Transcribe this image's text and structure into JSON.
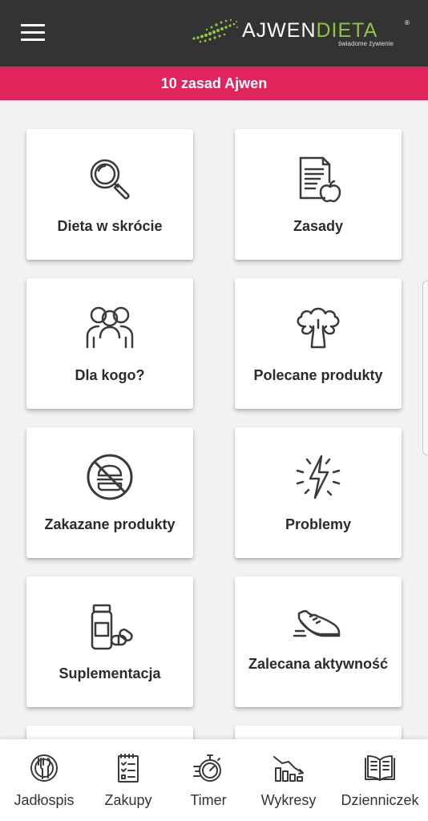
{
  "header": {
    "logo_word1": "AJWEN",
    "logo_word2": "DIETA",
    "logo_reg": "®",
    "logo_tagline": "świadome żywienie"
  },
  "banner": {
    "title": "10 zasad Ajwen"
  },
  "tiles": [
    {
      "label": "Dieta w skrócie",
      "icon": "magnifier-icon"
    },
    {
      "label": "Zasady",
      "icon": "document-apple-icon"
    },
    {
      "label": "Dla kogo?",
      "icon": "people-icon"
    },
    {
      "label": "Polecane produkty",
      "icon": "broccoli-icon"
    },
    {
      "label": "Zakazane produkty",
      "icon": "no-burger-icon"
    },
    {
      "label": "Problemy",
      "icon": "lightning-icon"
    },
    {
      "label": "Suplementacja",
      "icon": "pills-icon"
    },
    {
      "label": "Zalecana aktywność",
      "icon": "shoe-icon"
    }
  ],
  "bottom_nav": [
    {
      "label": "Jadłospis",
      "icon": "plate-icon"
    },
    {
      "label": "Zakupy",
      "icon": "checklist-icon"
    },
    {
      "label": "Timer",
      "icon": "stopwatch-icon"
    },
    {
      "label": "Wykresy",
      "icon": "chart-icon"
    },
    {
      "label": "Dzienniczek",
      "icon": "book-icon"
    }
  ],
  "colors": {
    "topbar": "#333333",
    "accent_pink": "#e2245c",
    "logo_green": "#8cc63f",
    "icon_stroke": "#3a3a3a"
  }
}
